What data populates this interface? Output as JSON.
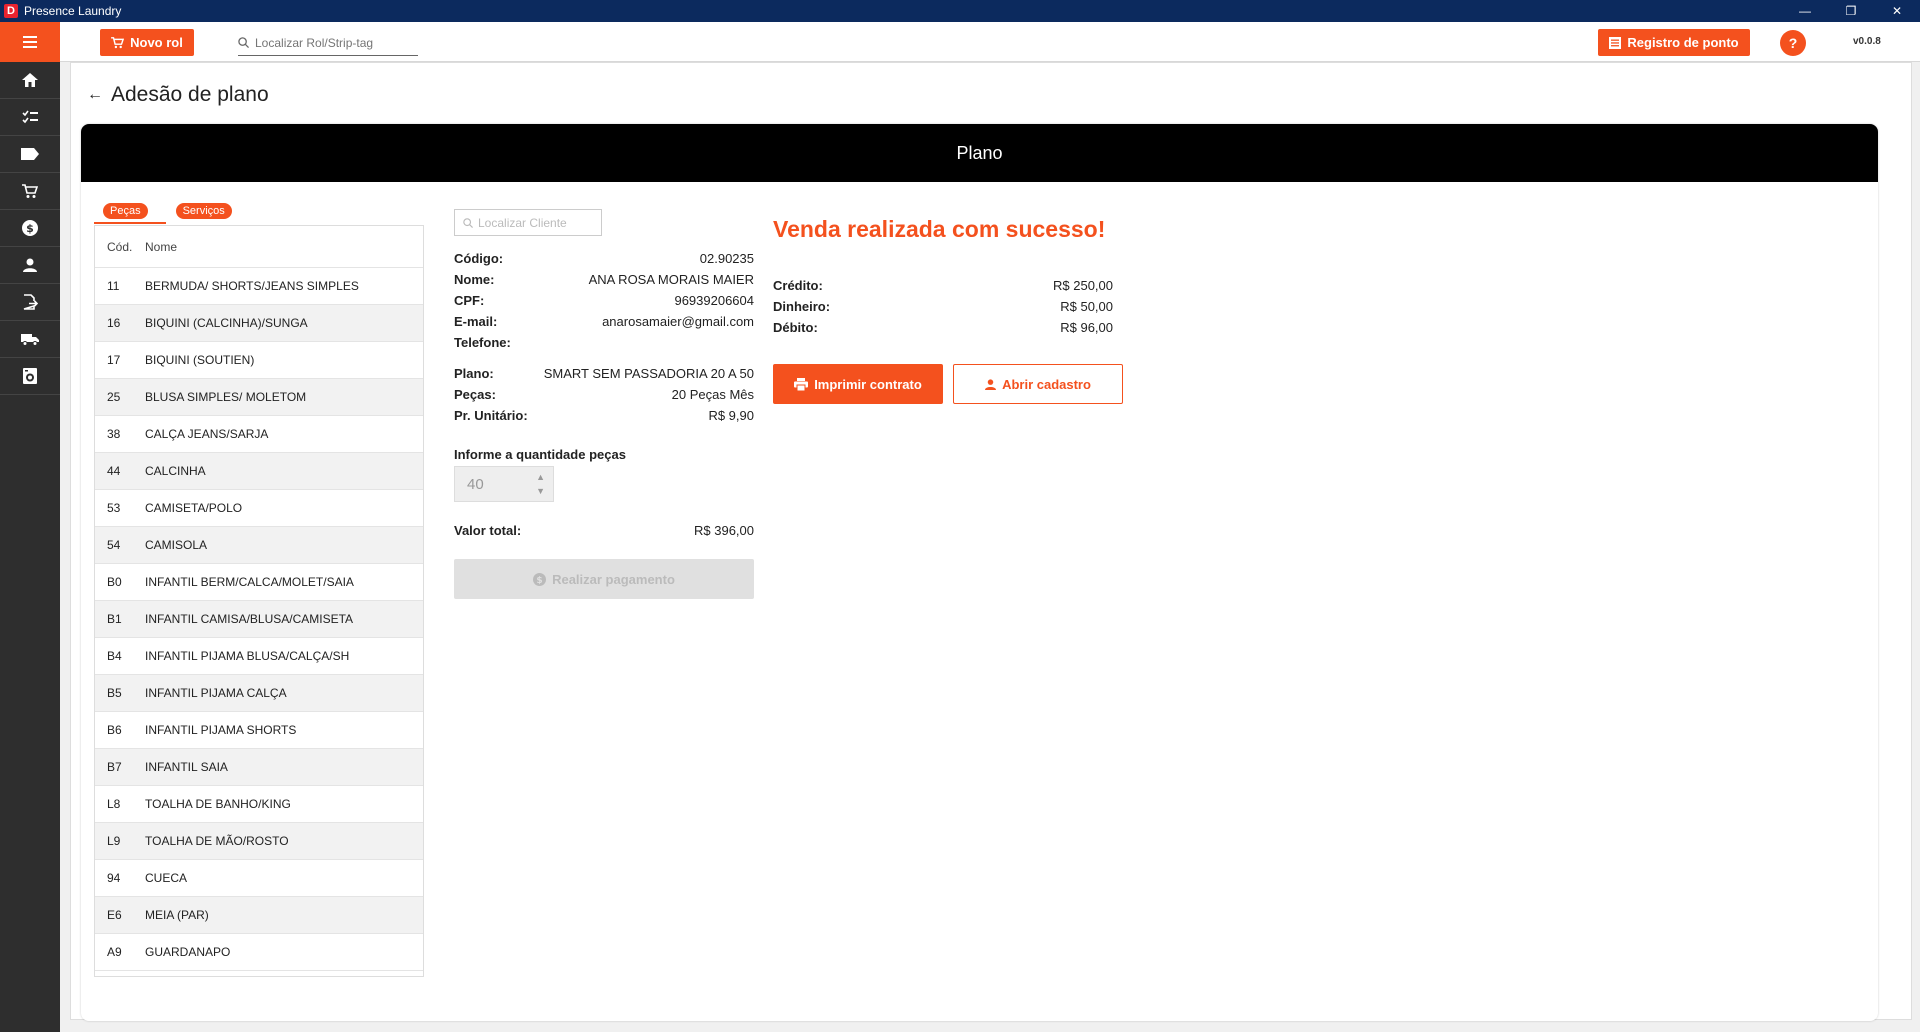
{
  "window": {
    "title": "Presence Laundry",
    "logo_letter": "D"
  },
  "topbar": {
    "novo_rol_label": "Novo rol",
    "search_placeholder": "Localizar Rol/Strip-tag",
    "registro_label": "Registro de ponto",
    "help_label": "?",
    "version": "v0.0.8"
  },
  "page": {
    "title": "Adesão de plano",
    "card_title": "Plano"
  },
  "tabs": [
    {
      "label": "Peças"
    },
    {
      "label": "Serviços"
    }
  ],
  "table": {
    "headers": {
      "code": "Cód.",
      "name": "Nome"
    },
    "rows": [
      {
        "code": "11",
        "name": "BERMUDA/ SHORTS/JEANS SIMPLES"
      },
      {
        "code": "16",
        "name": "BIQUINI (CALCINHA)/SUNGA"
      },
      {
        "code": "17",
        "name": "BIQUINI (SOUTIEN)"
      },
      {
        "code": "25",
        "name": "BLUSA SIMPLES/ MOLETOM"
      },
      {
        "code": "38",
        "name": "CALÇA JEANS/SARJA"
      },
      {
        "code": "44",
        "name": "CALCINHA"
      },
      {
        "code": "53",
        "name": "CAMISETA/POLO"
      },
      {
        "code": "54",
        "name": "CAMISOLA"
      },
      {
        "code": "B0",
        "name": "INFANTIL BERM/CALCA/MOLET/SAIA"
      },
      {
        "code": "B1",
        "name": "INFANTIL CAMISA/BLUSA/CAMISETA"
      },
      {
        "code": "B4",
        "name": "INFANTIL PIJAMA BLUSA/CALÇA/SH"
      },
      {
        "code": "B5",
        "name": "INFANTIL PIJAMA CALÇA"
      },
      {
        "code": "B6",
        "name": "INFANTIL PIJAMA SHORTS"
      },
      {
        "code": "B7",
        "name": "INFANTIL SAIA"
      },
      {
        "code": "L8",
        "name": "TOALHA DE BANHO/KING"
      },
      {
        "code": "L9",
        "name": "TOALHA DE MÃO/ROSTO"
      },
      {
        "code": "94",
        "name": "CUECA"
      },
      {
        "code": "E6",
        "name": "MEIA (PAR)"
      },
      {
        "code": "A9",
        "name": "GUARDANAPO"
      }
    ]
  },
  "cliente": {
    "search_placeholder": "Localizar Cliente",
    "codigo_label": "Código:",
    "codigo": "02.90235",
    "nome_label": "Nome:",
    "nome": "ANA ROSA MORAIS MAIER",
    "cpf_label": "CPF:",
    "cpf": "96939206604",
    "email_label": "E-mail:",
    "email": "anarosamaier@gmail.com",
    "telefone_label": "Telefone:",
    "telefone": ""
  },
  "plano": {
    "plano_label": "Plano:",
    "plano": "SMART SEM PASSADORIA 20 A 50",
    "pecas_label": "Peças:",
    "pecas": "20 Peças Mês",
    "unit_label": "Pr. Unitário:",
    "unit": "R$ 9,90",
    "qty_label": "Informe a quantidade peças",
    "qty": "40",
    "total_label": "Valor total:",
    "total": "R$ 396,00",
    "pay_button": "Realizar pagamento"
  },
  "result": {
    "message": "Venda realizada com sucesso!",
    "credito_label": "Crédito:",
    "credito": "R$ 250,00",
    "dinheiro_label": "Dinheiro:",
    "dinheiro": "R$ 50,00",
    "debito_label": "Débito:",
    "debito": "R$ 96,00",
    "print_button": "Imprimir contrato",
    "cadastro_button": "Abrir cadastro"
  },
  "colors": {
    "accent": "#f4511e",
    "titlebar": "#0c2a5e",
    "sidebar": "#2e2e2e"
  }
}
